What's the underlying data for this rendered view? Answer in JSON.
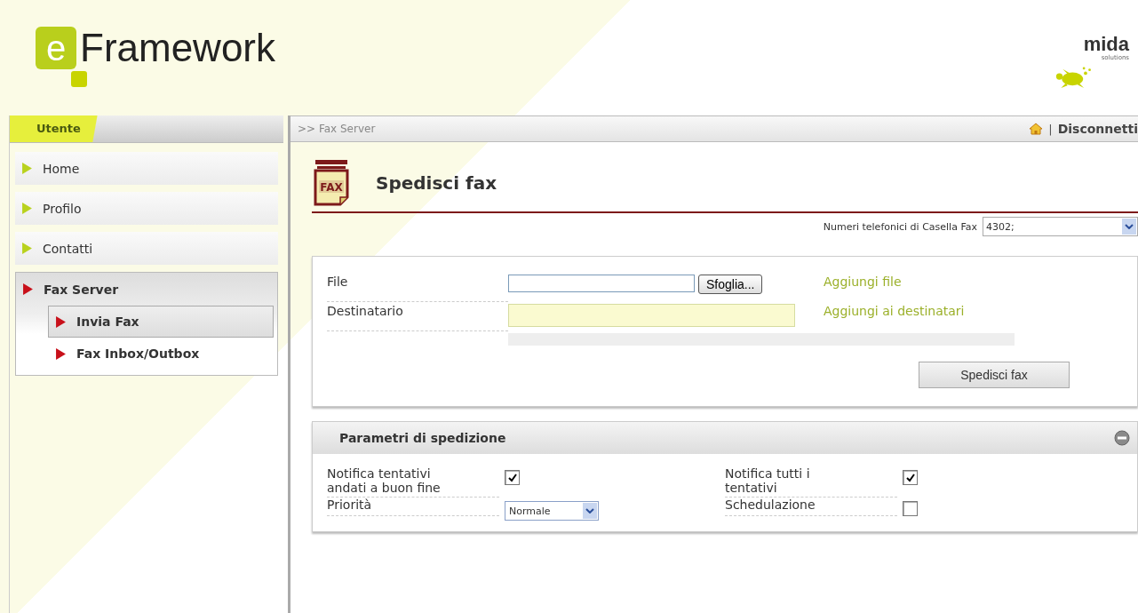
{
  "header": {
    "logo": {
      "letter": "e",
      "name": "Framework"
    },
    "partner_logo": {
      "name": "mida",
      "tagline": "solutions"
    }
  },
  "sidebar": {
    "title": "Utente",
    "items": [
      {
        "label": "Home",
        "expanded": false
      },
      {
        "label": "Profilo",
        "expanded": false
      },
      {
        "label": "Contatti",
        "expanded": false
      },
      {
        "label": "Fax Server",
        "expanded": true,
        "children": [
          {
            "label": "Invia Fax",
            "selected": true
          },
          {
            "label": "Fax Inbox/Outbox",
            "selected": false
          }
        ]
      }
    ]
  },
  "breadcrumb": ">> Fax Server",
  "user_links": {
    "separator": "|",
    "logout": "Disconnetti"
  },
  "page_title": "Spedisci fax",
  "page_icon_text": "FAX",
  "mailbox": {
    "label": "Numeri telefonici di Casella Fax",
    "value": "4302;"
  },
  "send_form": {
    "file_label": "File",
    "browse_button": "Sfoglia...",
    "add_file": "Aggiungi file",
    "recipient_label": "Destinatario",
    "add_recipient": "Aggiungi ai destinatari",
    "submit": "Spedisci fax"
  },
  "parameters": {
    "title": "Parametri di spedizione",
    "fields": [
      {
        "label": "Notifica tentativi andati a buon fine",
        "kind": "checkbox",
        "checked": true
      },
      {
        "label": "Notifica tutti i tentativi",
        "kind": "checkbox",
        "checked": true
      },
      {
        "label": "Priorità",
        "kind": "select",
        "value": "Normale"
      },
      {
        "label": "Schedulazione",
        "kind": "checkbox",
        "checked": false
      }
    ]
  }
}
